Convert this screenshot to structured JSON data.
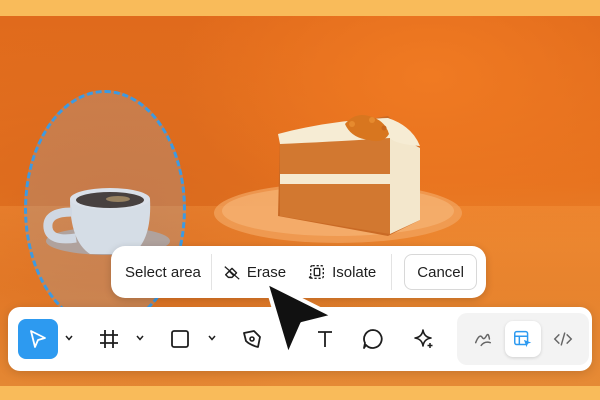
{
  "selection_toolbar": {
    "label": "Select area",
    "erase_label": "Erase",
    "isolate_label": "Isolate",
    "cancel_label": "Cancel"
  },
  "main_toolbar": {
    "tools": [
      {
        "name": "move-tool",
        "icon": "arrow-pointer-icon",
        "active": true
      },
      {
        "name": "frame-tool",
        "icon": "hash-frame-icon"
      },
      {
        "name": "shape-tool",
        "icon": "square-icon"
      },
      {
        "name": "pen-tool",
        "icon": "pen-nib-icon"
      },
      {
        "name": "text-tool",
        "icon": "text-t-icon"
      },
      {
        "name": "comment-tool",
        "icon": "speech-bubble-icon"
      },
      {
        "name": "ai-tool",
        "icon": "sparkle-icon"
      }
    ],
    "mode_switch": [
      {
        "name": "draw-mode",
        "icon": "scribble-icon"
      },
      {
        "name": "design-mode",
        "icon": "layout-cursor-icon",
        "active": true
      },
      {
        "name": "dev-mode",
        "icon": "code-brackets-icon"
      }
    ]
  },
  "colors": {
    "accent": "#2d9af0",
    "selection_dash": "#3d9ae2",
    "background_outer": "#f9bb5a",
    "photo_orange": "#e7731f"
  }
}
